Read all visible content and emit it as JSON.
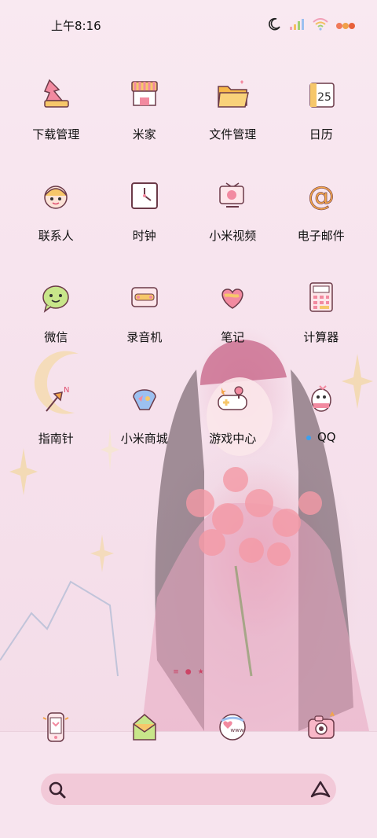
{
  "status_bar": {
    "time": "上午8:16",
    "icons": [
      "moon-icon",
      "signal-icon",
      "wifi-icon",
      "battery-icon"
    ]
  },
  "apps": [
    {
      "label": "下载管理",
      "icon": "download-manager-icon"
    },
    {
      "label": "米家",
      "icon": "mijia-icon"
    },
    {
      "label": "文件管理",
      "icon": "folder-icon"
    },
    {
      "label": "日历",
      "icon": "calendar-icon",
      "icon_text": "25"
    },
    {
      "label": "联系人",
      "icon": "contacts-icon"
    },
    {
      "label": "时钟",
      "icon": "clock-icon"
    },
    {
      "label": "小米视频",
      "icon": "tv-icon"
    },
    {
      "label": "电子邮件",
      "icon": "email-icon",
      "icon_text": "@"
    },
    {
      "label": "微信",
      "icon": "wechat-icon"
    },
    {
      "label": "录音机",
      "icon": "recorder-icon"
    },
    {
      "label": "笔记",
      "icon": "notes-icon"
    },
    {
      "label": "计算器",
      "icon": "calculator-icon"
    },
    {
      "label": "指南针",
      "icon": "compass-icon"
    },
    {
      "label": "小米商城",
      "icon": "mi-store-icon"
    },
    {
      "label": "游戏中心",
      "icon": "game-center-icon"
    },
    {
      "label": "QQ",
      "icon": "qq-icon",
      "has_update_dot": true
    }
  ],
  "dock": [
    {
      "icon": "phone-icon"
    },
    {
      "icon": "messages-icon"
    },
    {
      "icon": "browser-icon",
      "icon_text": "www"
    },
    {
      "icon": "camera-icon"
    }
  ],
  "pager": {
    "pages": 3,
    "current": 2
  },
  "search": {
    "left_icon": "search-icon",
    "right_icon": "assistant-icon"
  },
  "colors": {
    "accent": "#e87aa0",
    "outline": "#6b3a48",
    "orange": "#f3a54a",
    "dot": "#3aa0f0"
  }
}
